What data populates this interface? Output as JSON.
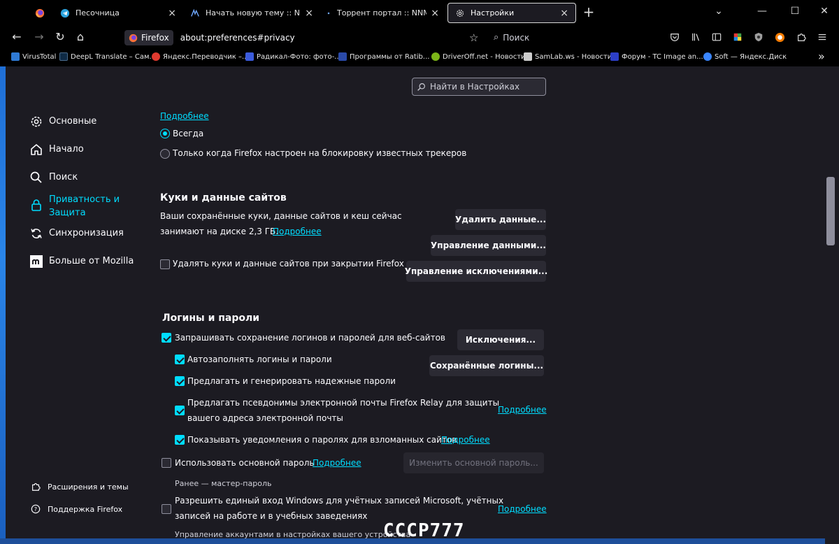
{
  "tabs": [
    {
      "label": "",
      "icon": "firefox-icon"
    },
    {
      "label": "Песочница",
      "icon": "telegram-icon",
      "close": "×"
    },
    {
      "label": "Начать новую тему :: NNM-Cl",
      "icon": "nnm-icon",
      "close": "×"
    },
    {
      "label": "Торрент портал :: NNM-Club",
      "icon": "dot-icon",
      "close": "×"
    },
    {
      "label": "Настройки",
      "icon": "gear-icon",
      "close": "×",
      "active": true
    }
  ],
  "new_tab": "+",
  "window_controls": {
    "list": "⌄",
    "minimize": "—",
    "maximize": "☐",
    "close": "✕"
  },
  "urlbar": {
    "identity": "Firefox",
    "url": "about:preferences#privacy"
  },
  "search": {
    "placeholder": "Поиск"
  },
  "bookmarks": [
    {
      "label": "VirusTotal",
      "color": "#2f7bd6"
    },
    {
      "label": "DeepL Translate – Сам...",
      "color": "#0f2b46"
    },
    {
      "label": "Яндекс.Переводчик –...",
      "color": "#e03a2f"
    },
    {
      "label": "Радикал-Фото: фото-...",
      "color": "#3b5bdb"
    },
    {
      "label": "Программы от Ratib...",
      "color": "#2a4aa8"
    },
    {
      "label": "DriverOff.net - Новости",
      "color": "#7cb518"
    },
    {
      "label": "SamLab.ws - Новости",
      "color": "#cccccc"
    },
    {
      "label": "Форум - TC Image an...",
      "color": "#2d3fc8"
    },
    {
      "label": "Soft — Яндекс.Диск",
      "color": "#3a86ff"
    }
  ],
  "bookmarks_more": "»",
  "settings_search": {
    "placeholder": "Найти в Настройках"
  },
  "categories": [
    {
      "label": "Основные",
      "icon": "gear-icon"
    },
    {
      "label": "Начало",
      "icon": "home-icon"
    },
    {
      "label": "Поиск",
      "icon": "search-icon"
    },
    {
      "label": "Приватность и Защита",
      "icon": "lock-icon",
      "selected": true
    },
    {
      "label": "Синхронизация",
      "icon": "sync-icon"
    },
    {
      "label": "Больше от Mozilla",
      "icon": "mozilla-icon"
    }
  ],
  "footer": {
    "extensions": "Расширения и темы",
    "support": "Поддержка Firefox"
  },
  "dnt": {
    "learn_more": "Подробнее",
    "always": "Всегда",
    "only_when": "Только когда Firefox настроен на блокировку известных трекеров"
  },
  "cookies": {
    "heading": "Куки и данные сайтов",
    "desc_line1": "Ваши сохранённые куки, данные сайтов и кеш сейчас",
    "desc_line2": "занимают на диске 2,3 ГБ.",
    "learn_more": "Подробнее",
    "clear_btn": "Удалить данные...",
    "manage_btn": "Управление данными...",
    "exceptions_btn": "Управление исключениями...",
    "delete_on_close": "Удалять куки и данные сайтов при закрытии Firefox"
  },
  "logins": {
    "heading": "Логины и пароли",
    "ask_save": "Запрашивать сохранение логинов и паролей для веб-сайтов",
    "exceptions_btn": "Исключения...",
    "autofill": "Автозаполнять логины и пароли",
    "saved_btn": "Сохранённые логины...",
    "suggest_passwords": "Предлагать и генерировать надежные пароли",
    "relay_line1": "Предлагать псевдонимы электронной почты Firefox Relay для защиты",
    "relay_line2": "вашего адреса электронной почты",
    "relay_learn_more": "Подробнее",
    "breach_alerts": "Показывать уведомления о паролях для взломанных сайтов",
    "breach_learn_more": "Подробнее",
    "primary_password": "Использовать основной пароль",
    "primary_learn_more": "Подробнее",
    "change_primary_btn": "Изменить основной пароль...",
    "formerly": "Ранее — мастер-пароль",
    "windows_sso_line1": "Разрешить единый вход Windows для учётных записей Microsoft, учётных",
    "windows_sso_line2": "записей на работе и в учебных заведениях",
    "windows_sso_learn_more": "Подробнее",
    "manage_accounts": "Управление аккаунтами в настройках вашего устройства"
  },
  "watermark": "СССР777",
  "colors": {
    "accent": "#00ddff",
    "background": "#1c1b22",
    "button": "#2b2a33"
  }
}
